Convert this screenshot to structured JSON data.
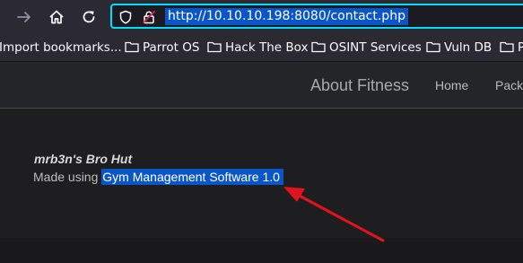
{
  "browser": {
    "url": "http://10.10.10.198:8080/contact.php",
    "accent": "#00ddff",
    "selection_color": "#0a56c8"
  },
  "bookmarks": {
    "import": "Import bookmarks...",
    "items": [
      "Parrot OS",
      "Hack The Box",
      "OSINT Services",
      "Vuln DB",
      "P"
    ]
  },
  "site": {
    "brand": "About Fitness",
    "nav": [
      "Home",
      "Pack"
    ],
    "title": "mrb3n's Bro Hut",
    "made_using_prefix": "Made using ",
    "software": "Gym Management Software 1.0"
  },
  "annotation": {
    "arrow_color": "#e0141c"
  }
}
